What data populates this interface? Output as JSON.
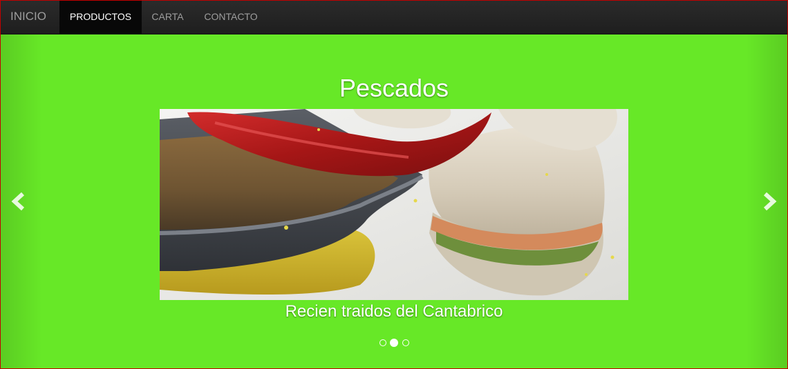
{
  "navbar": {
    "brand": "INICIO",
    "items": [
      {
        "label": "PRODUCTOS",
        "active": true
      },
      {
        "label": "CARTA",
        "active": false
      },
      {
        "label": "CONTACTO",
        "active": false
      }
    ]
  },
  "carousel": {
    "title": "Pescados",
    "caption": "Recien traidos del Cantabrico",
    "image_subject": "fish-dish-photo",
    "prev_icon": "chevron-left-icon",
    "next_icon": "chevron-right-icon",
    "slide_count": 3,
    "active_slide": 2
  },
  "colors": {
    "background": "#67e827",
    "navbar": "#222222",
    "nav_active": "#080808",
    "nav_text": "#9d9d9d",
    "text": "#ffffff",
    "border": "#c40000"
  }
}
